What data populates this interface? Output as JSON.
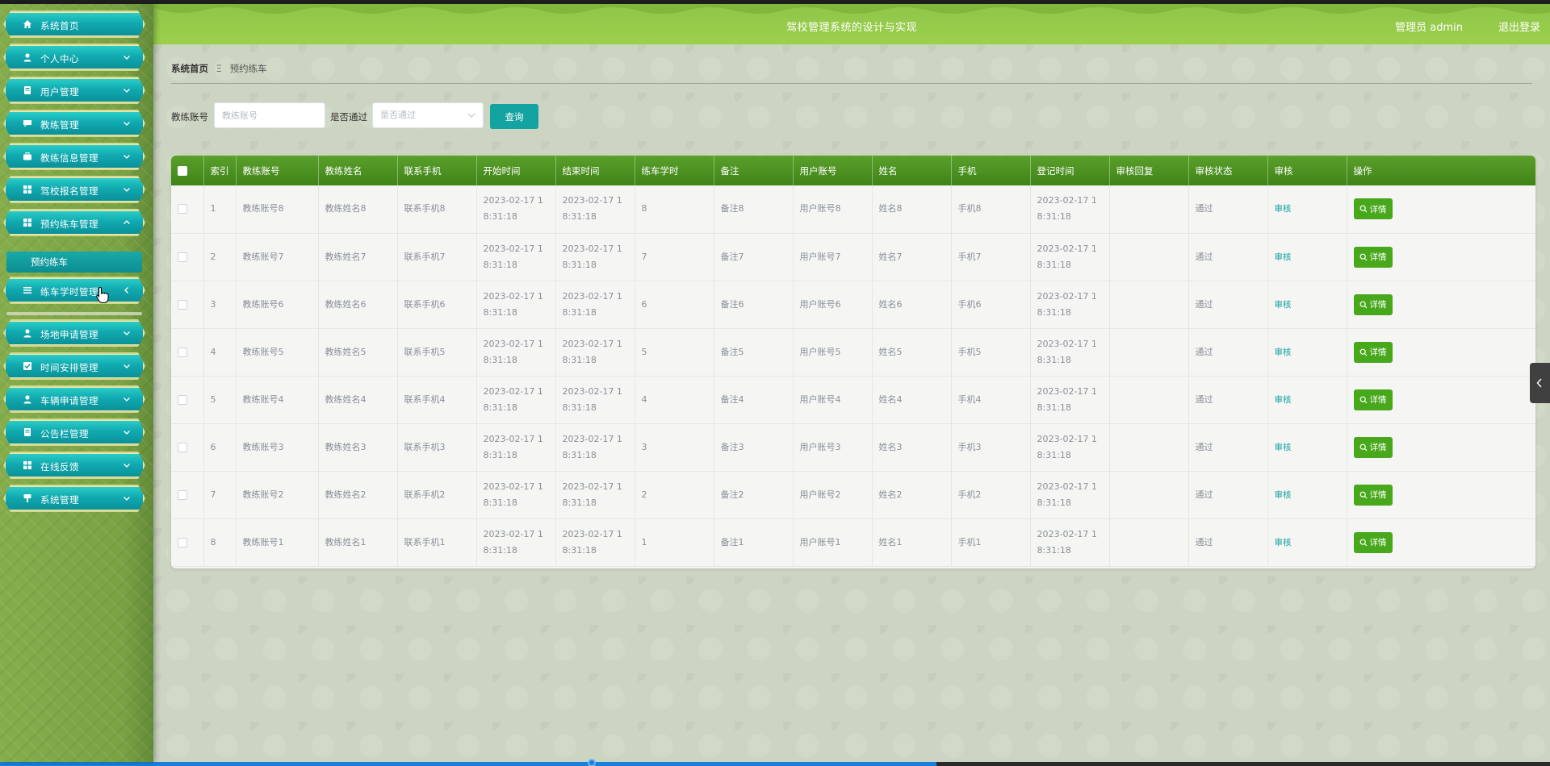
{
  "app": {
    "title": "驾校管理系统的设计与实现",
    "user_label": "管理员 admin",
    "logout_label": "退出登录"
  },
  "sidebar": {
    "items": [
      {
        "label": "系统首页",
        "icon": "home-icon"
      },
      {
        "label": "个人中心",
        "icon": "user-icon"
      },
      {
        "label": "用户管理",
        "icon": "document-icon"
      },
      {
        "label": "教练管理",
        "icon": "chat-icon"
      },
      {
        "label": "教练信息管理",
        "icon": "briefcase-icon"
      },
      {
        "label": "驾校报名管理",
        "icon": "grid-icon"
      },
      {
        "label": "预约练车管理",
        "icon": "grid-icon"
      },
      {
        "label": "练车学时管理",
        "icon": "list-icon"
      },
      {
        "label": "场地申请管理",
        "icon": "user-icon"
      },
      {
        "label": "时间安排管理",
        "icon": "checkbox-icon"
      },
      {
        "label": "车辆申请管理",
        "icon": "user-icon"
      },
      {
        "label": "公告栏管理",
        "icon": "document-icon"
      },
      {
        "label": "在线反馈",
        "icon": "grid-icon"
      },
      {
        "label": "系统管理",
        "icon": "settings-icon"
      }
    ],
    "active_submenu": "预约练车"
  },
  "breadcrumb": {
    "home": "系统首页",
    "separator": "Ξ",
    "current": "预约练车"
  },
  "search": {
    "coach_label": "教练账号",
    "coach_placeholder": "教练账号",
    "pass_label": "是否通过",
    "pass_placeholder": "是否通过",
    "query_button": "查询"
  },
  "table": {
    "headers": [
      "索引",
      "教练账号",
      "教练姓名",
      "联系手机",
      "开始时间",
      "结束时间",
      "练车学时",
      "备注",
      "用户账号",
      "姓名",
      "手机",
      "登记时间",
      "审核回复",
      "审核状态",
      "审核",
      "操作"
    ],
    "rows": [
      {
        "index": "1",
        "coach_account": "教练账号8",
        "coach_name": "教练姓名8",
        "coach_phone": "联系手机8",
        "start": "2023-02-17 18:31:18",
        "end": "2023-02-17 18:31:18",
        "hours": "8",
        "remark": "备注8",
        "user_account": "用户账号8",
        "name": "姓名8",
        "phone": "手机8",
        "register_time": "2023-02-17 18:31:18",
        "reply": "",
        "status": "通过",
        "audit": "审核",
        "detail": "详情"
      },
      {
        "index": "2",
        "coach_account": "教练账号7",
        "coach_name": "教练姓名7",
        "coach_phone": "联系手机7",
        "start": "2023-02-17 18:31:18",
        "end": "2023-02-17 18:31:18",
        "hours": "7",
        "remark": "备注7",
        "user_account": "用户账号7",
        "name": "姓名7",
        "phone": "手机7",
        "register_time": "2023-02-17 18:31:18",
        "reply": "",
        "status": "通过",
        "audit": "审核",
        "detail": "详情"
      },
      {
        "index": "3",
        "coach_account": "教练账号6",
        "coach_name": "教练姓名6",
        "coach_phone": "联系手机6",
        "start": "2023-02-17 18:31:18",
        "end": "2023-02-17 18:31:18",
        "hours": "6",
        "remark": "备注6",
        "user_account": "用户账号6",
        "name": "姓名6",
        "phone": "手机6",
        "register_time": "2023-02-17 18:31:18",
        "reply": "",
        "status": "通过",
        "audit": "审核",
        "detail": "详情"
      },
      {
        "index": "4",
        "coach_account": "教练账号5",
        "coach_name": "教练姓名5",
        "coach_phone": "联系手机5",
        "start": "2023-02-17 18:31:18",
        "end": "2023-02-17 18:31:18",
        "hours": "5",
        "remark": "备注5",
        "user_account": "用户账号5",
        "name": "姓名5",
        "phone": "手机5",
        "register_time": "2023-02-17 18:31:18",
        "reply": "",
        "status": "通过",
        "audit": "审核",
        "detail": "详情"
      },
      {
        "index": "5",
        "coach_account": "教练账号4",
        "coach_name": "教练姓名4",
        "coach_phone": "联系手机4",
        "start": "2023-02-17 18:31:18",
        "end": "2023-02-17 18:31:18",
        "hours": "4",
        "remark": "备注4",
        "user_account": "用户账号4",
        "name": "姓名4",
        "phone": "手机4",
        "register_time": "2023-02-17 18:31:18",
        "reply": "",
        "status": "通过",
        "audit": "审核",
        "detail": "详情"
      },
      {
        "index": "6",
        "coach_account": "教练账号3",
        "coach_name": "教练姓名3",
        "coach_phone": "联系手机3",
        "start": "2023-02-17 18:31:18",
        "end": "2023-02-17 18:31:18",
        "hours": "3",
        "remark": "备注3",
        "user_account": "用户账号3",
        "name": "姓名3",
        "phone": "手机3",
        "register_time": "2023-02-17 18:31:18",
        "reply": "",
        "status": "通过",
        "audit": "审核",
        "detail": "详情"
      },
      {
        "index": "7",
        "coach_account": "教练账号2",
        "coach_name": "教练姓名2",
        "coach_phone": "联系手机2",
        "start": "2023-02-17 18:31:18",
        "end": "2023-02-17 18:31:18",
        "hours": "2",
        "remark": "备注2",
        "user_account": "用户账号2",
        "name": "姓名2",
        "phone": "手机2",
        "register_time": "2023-02-17 18:31:18",
        "reply": "",
        "status": "通过",
        "audit": "审核",
        "detail": "详情"
      },
      {
        "index": "8",
        "coach_account": "教练账号1",
        "coach_name": "教练姓名1",
        "coach_phone": "联系手机1",
        "start": "2023-02-17 18:31:18",
        "end": "2023-02-17 18:31:18",
        "hours": "1",
        "remark": "备注1",
        "user_account": "用户账号1",
        "name": "姓名1",
        "phone": "手机1",
        "register_time": "2023-02-17 18:31:18",
        "reply": "",
        "status": "通过",
        "audit": "审核",
        "detail": "详情"
      }
    ]
  },
  "colors": {
    "header_green": "#8fc64a",
    "sidebar_green": "#7ea848",
    "menu_teal": "#11aab0",
    "table_header": "#4b9221",
    "detail_button": "#48a81c",
    "query_button": "#13a3a0"
  }
}
